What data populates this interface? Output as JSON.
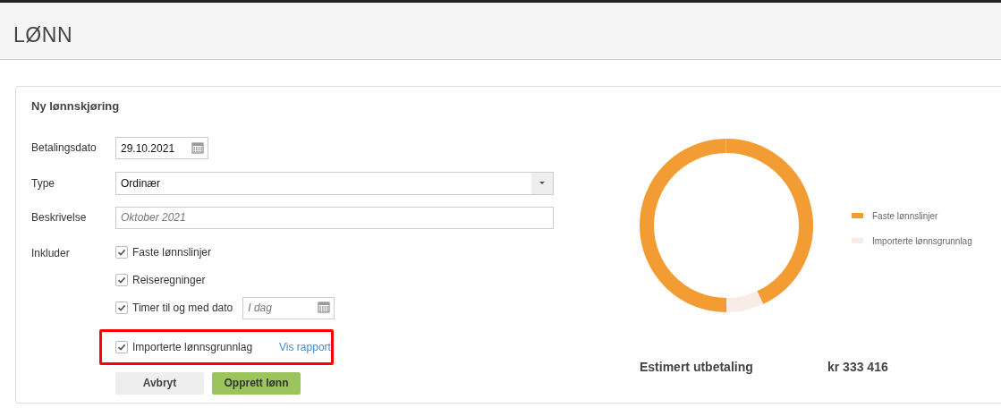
{
  "page": {
    "title": "LØNN"
  },
  "form": {
    "title": "Ny lønnskjøring",
    "payment_date": {
      "label": "Betalingsdato",
      "value": "29.10.2021"
    },
    "type": {
      "label": "Type",
      "value": "Ordinær"
    },
    "description": {
      "label": "Beskrivelse",
      "placeholder": "Oktober 2021"
    },
    "include": {
      "label": "Inkluder",
      "options": [
        {
          "label": "Faste lønnslinjer",
          "checked": true,
          "highlighted": false
        },
        {
          "label": "Reiseregninger",
          "checked": true,
          "highlighted": false
        },
        {
          "label": "Timer til og med dato",
          "checked": true,
          "highlighted": false,
          "date_placeholder": "I dag"
        },
        {
          "label": "Importerte lønnsgrunnlag",
          "checked": true,
          "highlighted": true,
          "link": "Vis rapport"
        }
      ]
    },
    "buttons": [
      {
        "label": "Avbryt",
        "kind": "secondary"
      },
      {
        "label": "Opprett lønn",
        "kind": "primary"
      }
    ]
  },
  "summary": {
    "legend": [
      {
        "label": "Faste lønnslinjer",
        "color": "#f39c34"
      },
      {
        "label": "Importerte lønnsgrunnlag",
        "color": "#f7ede6"
      }
    ],
    "estimate_label": "Estimert utbetaling",
    "estimate_value": "kr 333 416"
  }
}
